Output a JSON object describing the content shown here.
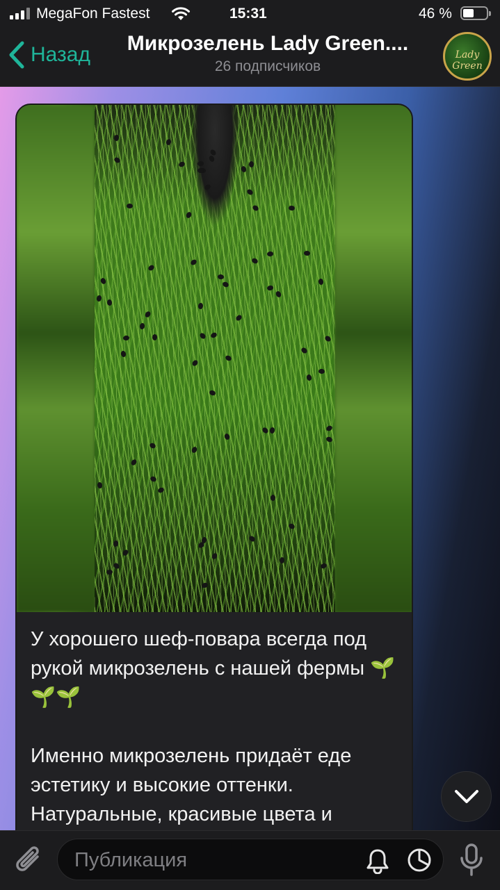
{
  "status_bar": {
    "carrier": "MegaFon Fastest",
    "time": "15:31",
    "battery_percent": "46 %",
    "battery_level": 0.46,
    "icons": [
      "signal-icon",
      "wifi-icon",
      "battery-icon"
    ]
  },
  "header": {
    "back_label": "Назад",
    "title": "Микрозелень Lady Green....",
    "subtitle": "26 подписчиков",
    "avatar_text": "Lady Green"
  },
  "message": {
    "paragraph1": "У хорошего шеф-повара всегда под рукой микрозелень с нашей фермы",
    "paragraph1_emoji": "🌱🌱🌱",
    "paragraph2": "Именно микрозелень придаёт еде эстетику и высокие оттенки. Натуральные, красивые цвета и"
  },
  "input_bar": {
    "placeholder": "Публикация",
    "icons": [
      "paperclip-icon",
      "bell-icon",
      "timer-icon",
      "microphone-icon"
    ]
  },
  "colors": {
    "accent": "#1fb59a",
    "bar_background": "#1c1c1e",
    "bubble_background": "#212124"
  }
}
